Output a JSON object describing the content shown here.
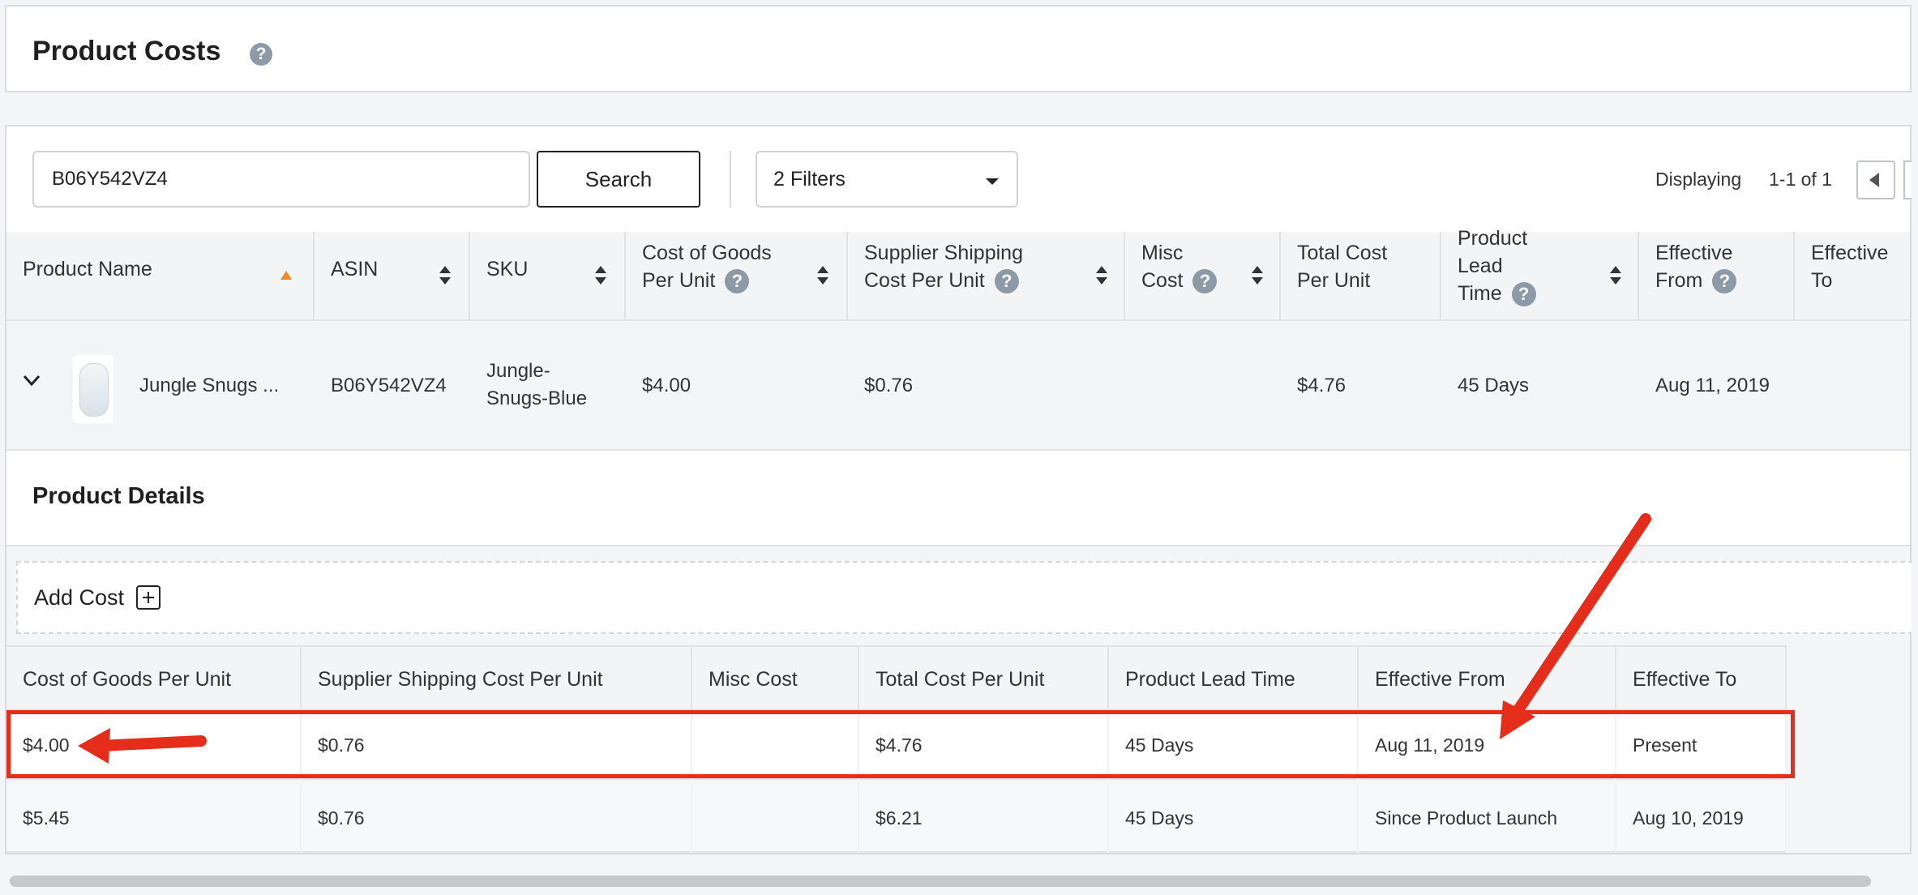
{
  "page": {
    "title": "Product Costs"
  },
  "toolbar": {
    "search_value": "B06Y542VZ4",
    "search_label": "Search",
    "filter_label": "2 Filters",
    "displaying_label": "Displaying",
    "range_text": "1-1  of 1"
  },
  "table": {
    "headers": {
      "product_name": "Product Name",
      "asin": "ASIN",
      "sku": "SKU",
      "cogs_1": "Cost of Goods",
      "cogs_2": "Per Unit",
      "ship_1": "Supplier Shipping",
      "ship_2": "Cost Per Unit",
      "misc_1": "Misc",
      "misc_2": "Cost",
      "total_1": "Total Cost",
      "total_2": "Per Unit",
      "lead_1": "Product",
      "lead_2": "Lead",
      "lead_3": "Time",
      "from_1": "Effective",
      "from_2": "From",
      "to_1": "Effective",
      "to_2": "To"
    },
    "row": {
      "product_name": "Jungle Snugs ...",
      "asin": "B06Y542VZ4",
      "sku_1": "Jungle-",
      "sku_2": "Snugs-Blue",
      "cogs": "$4.00",
      "shipping": "$0.76",
      "misc": "",
      "total": "$4.76",
      "lead_time": "45 Days",
      "effective_from": "Aug 11, 2019"
    }
  },
  "details": {
    "title": "Product Details",
    "add_cost_label": "Add Cost",
    "headers": [
      "Cost of Goods Per Unit",
      "Supplier Shipping Cost Per Unit",
      "Misc Cost",
      "Total Cost Per Unit",
      "Product Lead Time",
      "Effective From",
      "Effective To"
    ],
    "rows": [
      [
        "$4.00",
        "$0.76",
        "",
        "$4.76",
        "45 Days",
        "Aug 11, 2019",
        "Present"
      ],
      [
        "$5.45",
        "$0.76",
        "",
        "$6.21",
        "45 Days",
        "Since Product Launch",
        "Aug 10, 2019"
      ]
    ]
  },
  "colors": {
    "annotation": "#e52d1c",
    "sort_active": "#f0892b",
    "help_icon": "#8c9aa8"
  },
  "icons": [
    "help-icon",
    "sort-icon",
    "chevron-down-icon",
    "caret-down-icon",
    "plus-box-icon",
    "chevron-left-icon"
  ]
}
